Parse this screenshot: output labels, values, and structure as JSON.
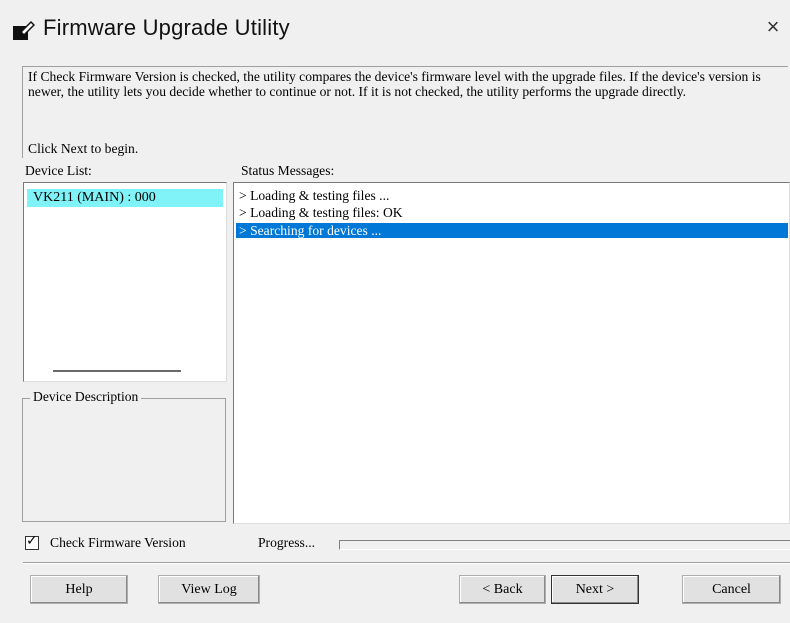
{
  "window": {
    "title": "Firmware Upgrade Utility",
    "close_glyph": "×",
    "title_icon": "firmware-utility-icon"
  },
  "intro": {
    "description": "If Check Firmware Version is checked, the utility compares the device's firmware level with the upgrade files. If the device's version is newer, the utility lets you decide whether to continue or not. If it is not checked, the utility performs the upgrade directly.",
    "begin": "Click Next to begin."
  },
  "device_list": {
    "label": "Device List:",
    "items": [
      "VK211 (MAIN) : 000"
    ],
    "selected_color": "#7ff3f8"
  },
  "device_description": {
    "label": "Device Description"
  },
  "status": {
    "label": "Status Messages:",
    "messages": [
      "> Loading & testing files ...",
      "> Loading & testing files: OK",
      "> Searching for devices ..."
    ],
    "selected_index": 2,
    "highlight_color": "#0078d7"
  },
  "options": {
    "check_firmware_label": "Check Firmware Version",
    "check_firmware_checked": true,
    "progress_label": "Progress...",
    "progress_fraction": 0.0
  },
  "buttons": {
    "help": "Help",
    "view_log": "View Log",
    "back": "< Back",
    "next": "Next >",
    "cancel": "Cancel"
  }
}
